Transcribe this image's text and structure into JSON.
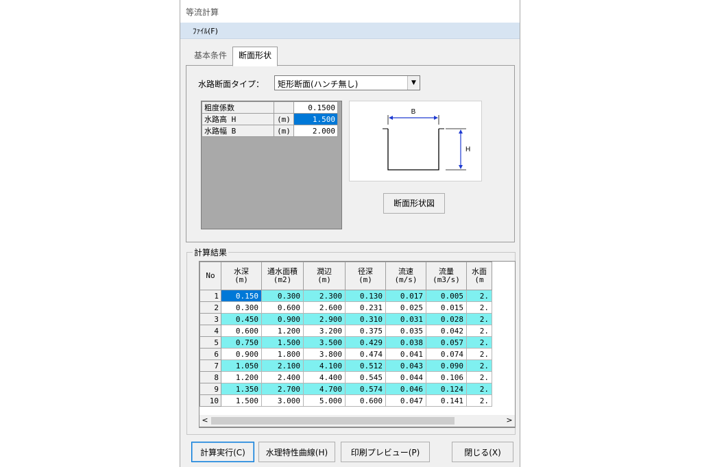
{
  "window": {
    "title": "等流計算"
  },
  "menu": {
    "file": "ﾌｧｲﾙ(F)"
  },
  "tabs": [
    {
      "label": "基本条件",
      "active": false
    },
    {
      "label": "断面形状",
      "active": true
    }
  ],
  "section": {
    "type_label": "水路断面タイプ：",
    "type_value": "矩形断面(ハンチ無し)",
    "params": [
      {
        "name": "粗度係数",
        "unit": "",
        "value": "0.1500"
      },
      {
        "name": "水路高 H",
        "unit": "(m)",
        "value": "1.500"
      },
      {
        "name": "水路幅 B",
        "unit": "(m)",
        "value": "2.000"
      }
    ],
    "diagram": {
      "label_b": "B",
      "label_h": "H"
    },
    "shape_button": "断面形状図"
  },
  "results": {
    "group_label": "計算結果",
    "headers": [
      {
        "top": "No",
        "unit": ""
      },
      {
        "top": "水深",
        "unit": "(m)"
      },
      {
        "top": "通水面積",
        "unit": "(m2)"
      },
      {
        "top": "潤辺",
        "unit": "(m)"
      },
      {
        "top": "径深",
        "unit": "(m)"
      },
      {
        "top": "流速",
        "unit": "(m/s)"
      },
      {
        "top": "流量",
        "unit": "(m3/s)"
      },
      {
        "top": "水面",
        "unit": "(m"
      }
    ],
    "rows": [
      [
        "1",
        "0.150",
        "0.300",
        "2.300",
        "0.130",
        "0.017",
        "0.005",
        "2."
      ],
      [
        "2",
        "0.300",
        "0.600",
        "2.600",
        "0.231",
        "0.025",
        "0.015",
        "2."
      ],
      [
        "3",
        "0.450",
        "0.900",
        "2.900",
        "0.310",
        "0.031",
        "0.028",
        "2."
      ],
      [
        "4",
        "0.600",
        "1.200",
        "3.200",
        "0.375",
        "0.035",
        "0.042",
        "2."
      ],
      [
        "5",
        "0.750",
        "1.500",
        "3.500",
        "0.429",
        "0.038",
        "0.057",
        "2."
      ],
      [
        "6",
        "0.900",
        "1.800",
        "3.800",
        "0.474",
        "0.041",
        "0.074",
        "2."
      ],
      [
        "7",
        "1.050",
        "2.100",
        "4.100",
        "0.512",
        "0.043",
        "0.090",
        "2."
      ],
      [
        "8",
        "1.200",
        "2.400",
        "4.400",
        "0.545",
        "0.044",
        "0.106",
        "2."
      ],
      [
        "9",
        "1.350",
        "2.700",
        "4.700",
        "0.574",
        "0.046",
        "0.124",
        "2."
      ],
      [
        "10",
        "1.500",
        "3.000",
        "5.000",
        "0.600",
        "0.047",
        "0.141",
        "2."
      ]
    ],
    "scroll_left": "<",
    "scroll_right": ">"
  },
  "buttons": {
    "calc": "計算実行(C)",
    "curve": "水理特性曲線(H)",
    "preview": "印刷プレビュー(P)",
    "close": "閉じる(X)"
  }
}
